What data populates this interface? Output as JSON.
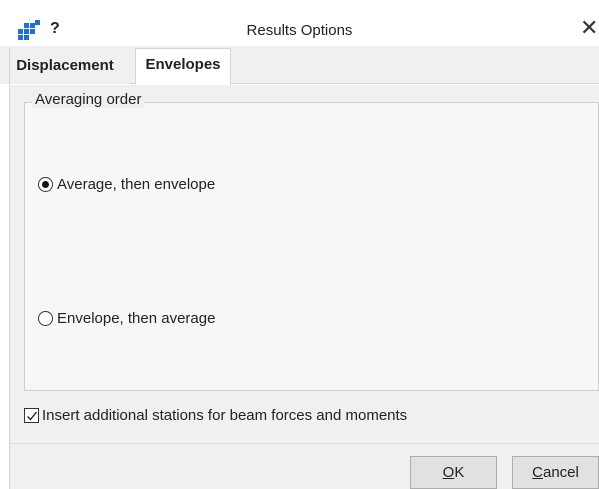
{
  "window": {
    "help_label": "?",
    "title": "Results Options",
    "close_glyph": "✕",
    "icon": "grid-app-icon"
  },
  "tabs": [
    {
      "label": "Displacement",
      "active": false
    },
    {
      "label": "Envelopes",
      "active": true
    }
  ],
  "averaging_order": {
    "legend": "Averaging order",
    "options": [
      {
        "label": "Average, then envelope",
        "selected": true
      },
      {
        "label": "Envelope, then average",
        "selected": false
      }
    ]
  },
  "insert_stations": {
    "label": "Insert additional stations for beam forces and moments",
    "checked": true
  },
  "buttons": {
    "ok_mnemonic": "O",
    "ok_rest": "K",
    "cancel_mnemonic": "C",
    "cancel_rest": "ancel"
  },
  "colors": {
    "icon_blue": "#1e6fd9",
    "panel_bg": "#f0f0f0"
  }
}
